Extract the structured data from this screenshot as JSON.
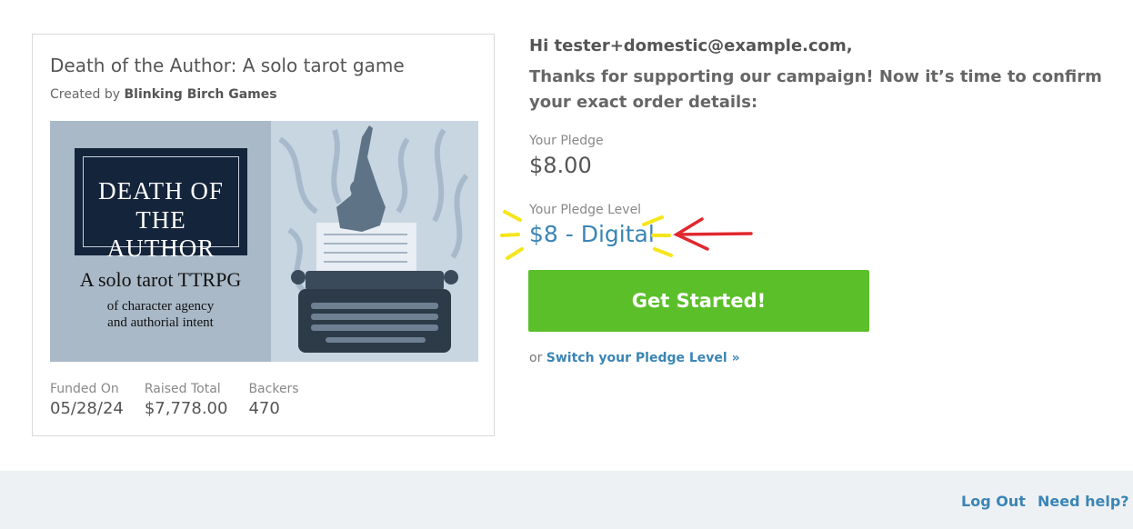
{
  "project": {
    "title": "Death of the Author: A solo tarot game",
    "created_by_prefix": "Created by ",
    "creator": "Blinking Birch Games",
    "cover": {
      "title_line1": "DEATH OF",
      "title_line2": "THE AUTHOR",
      "subtitle": "A solo tarot TTRPG",
      "tagline_line1": "of character agency",
      "tagline_line2": "and authorial intent"
    },
    "stats": [
      {
        "label": "Funded On",
        "value": "05/28/24"
      },
      {
        "label": "Raised Total",
        "value": "$7,778.00"
      },
      {
        "label": "Backers",
        "value": "470"
      }
    ]
  },
  "main": {
    "greeting": "Hi tester+domestic@example.com,",
    "thanks": "Thanks for supporting our campaign! Now it’s time to confirm your exact order details:",
    "pledge_label": "Your Pledge",
    "pledge_amount": "$8.00",
    "level_label": "Your Pledge Level",
    "level_value": "$8 - Digital",
    "cta_label": "Get Started!",
    "switch_prefix": "or ",
    "switch_link": "Switch your Pledge Level »"
  },
  "footer": {
    "logout": "Log Out",
    "help": "Need help?"
  },
  "colors": {
    "accent": "#3a85b5",
    "cta": "#5bbf2a",
    "annotation_highlight": "#f5e61b",
    "annotation_arrow": "#e0282e"
  }
}
